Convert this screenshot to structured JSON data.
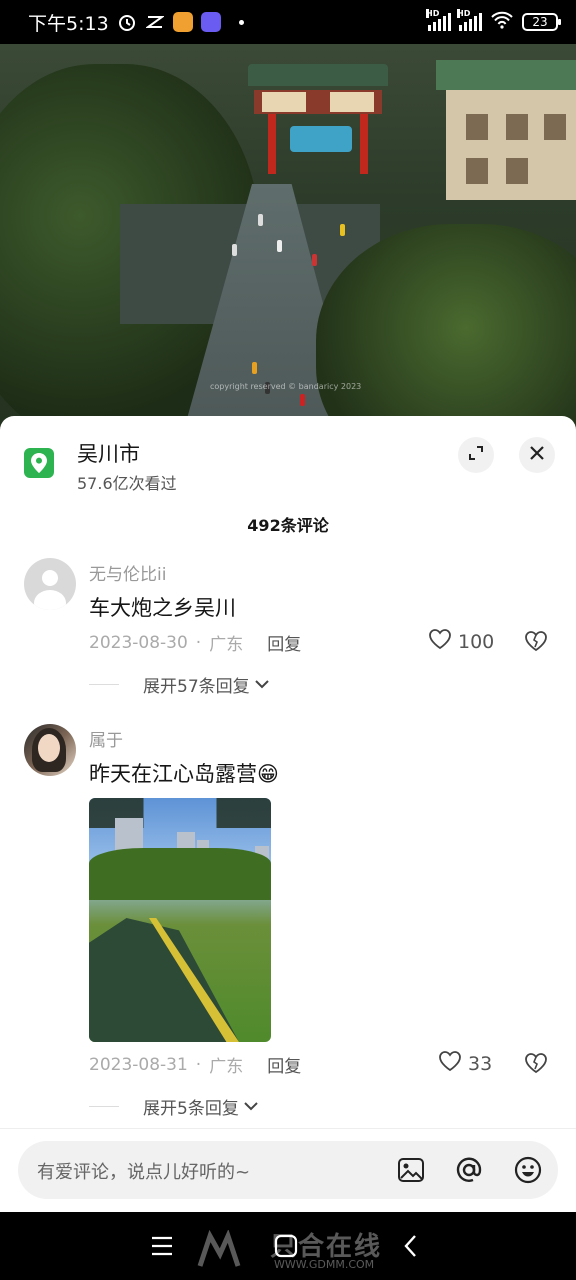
{
  "status_bar": {
    "time": "下午5:13",
    "signal1_label": "HD",
    "signal2_label": "HD",
    "battery": "23"
  },
  "video": {
    "watermark": "copyright reserved © bandaricy 2023"
  },
  "location": {
    "title": "吴川市",
    "views": "57.6亿次看过"
  },
  "comments_header": {
    "count": "492条评论"
  },
  "comments": [
    {
      "author": "无与伦比ii",
      "text": "车大炮之乡吴川",
      "date": "2023-08-30",
      "separator": "·",
      "region": "广东",
      "reply_label": "回复",
      "likes": "100",
      "expand_label": "展开57条回复"
    },
    {
      "author": "属于",
      "text": "昨天在江心岛露营😁",
      "date": "2023-08-31",
      "separator": "·",
      "region": "广东",
      "reply_label": "回复",
      "likes": "33",
      "expand_label": "展开5条回复"
    }
  ],
  "input": {
    "placeholder": "有爱评论，说点儿好听的~"
  },
  "nav_watermark": {
    "brand": "只合在线",
    "url": "WWW.GDMM.COM"
  },
  "colors": {
    "accent_green": "#2db450",
    "sheet_bg": "#ffffff",
    "muted_text": "#999999"
  }
}
